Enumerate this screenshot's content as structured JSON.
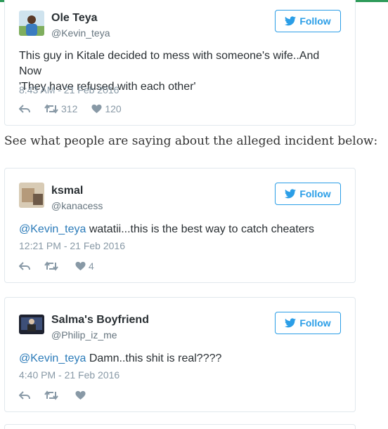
{
  "tweets": [
    {
      "name": "Ole Teya",
      "handle": "@Kevin_teya",
      "follow_label": "Follow",
      "mention": "",
      "text_line1": "This guy in Kitale decided to mess with someone's wife..And Now",
      "text_line2": "'They have refused with each other'",
      "timestamp": "8:43 AM - 21 Feb 2016",
      "retweets": "312",
      "likes": "120"
    },
    {
      "name": "ksmal",
      "handle": "@kanacess",
      "follow_label": "Follow",
      "mention": "@Kevin_teya",
      "text": " watatii...this is the best way to catch cheaters",
      "timestamp": "12:21 PM - 21 Feb 2016",
      "retweets": "",
      "likes": "4"
    },
    {
      "name": "Salma's Boyfriend",
      "handle": "@Philip_iz_me",
      "follow_label": "Follow",
      "mention": "@Kevin_teya",
      "text": " Damn..this shit is real????",
      "timestamp": "4:40 PM - 21 Feb 2016",
      "retweets": "",
      "likes": ""
    }
  ],
  "caption": "See what people are saying about the alleged incident below:",
  "colors": {
    "accent": "#2b9ee7",
    "mention": "#2b7bb9",
    "muted": "#8899a6",
    "border": "#e1e8ed",
    "top_bar": "#2e9b5a"
  },
  "icons": [
    "twitter-bird-icon",
    "reply-icon",
    "retweet-icon",
    "heart-icon"
  ]
}
